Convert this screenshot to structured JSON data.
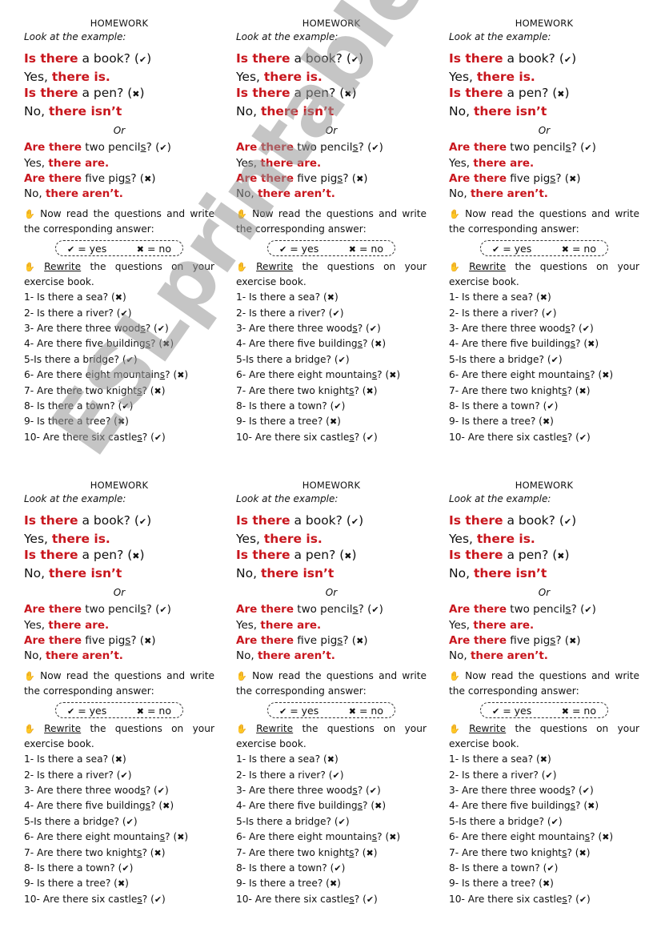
{
  "document": {
    "panel_count": 6,
    "title": "HOMEWORK",
    "look_label": "Look at the example:",
    "examples_singular": [
      {
        "red": "Is there",
        "rest": " a book? ",
        "mark": "✔"
      },
      {
        "prefix": "Yes, ",
        "red": "there is.",
        "rest": ""
      },
      {
        "red": "Is there",
        "rest": " a pen? ",
        "mark": "✖"
      },
      {
        "prefix": "No, ",
        "red": "there isn’t",
        "rest": ""
      }
    ],
    "or_label": "Or",
    "examples_plural": [
      {
        "red": "Are there",
        "rest_a": " two pencil",
        "rest_u": "s",
        "rest_b": "? ",
        "mark": "✔"
      },
      {
        "prefix": "Yes, ",
        "red": "there are.",
        "rest_a": "",
        "rest_u": "",
        "rest_b": ""
      },
      {
        "red": "Are there",
        "rest_a": " five pig",
        "rest_u": "s",
        "rest_b": "? ",
        "mark": "✖"
      },
      {
        "prefix": "No, ",
        "red": "there aren’t.",
        "rest_a": "",
        "rest_u": "",
        "rest_b": ""
      }
    ],
    "instruction_1": "Now read the questions and write the corresponding answer:",
    "legend": {
      "yes_mark": "✔",
      "yes_label": " = yes",
      "no_mark": "✖",
      "no_label": " = no"
    },
    "instruction_2_underlined": "Rewrite",
    "instruction_2_rest": " the questions on your exercise book.",
    "questions": [
      {
        "a": "1- Is there a sea? ",
        "u": "",
        "b": "",
        "mark": "✖"
      },
      {
        "a": "2- Is there a river? ",
        "u": "",
        "b": "",
        "mark": "✔"
      },
      {
        "a": "3- Are there three wood",
        "u": "s",
        "b": "? ",
        "mark": "✔"
      },
      {
        "a": "4- Are there five building",
        "u": "s",
        "b": "? ",
        "mark": "✖"
      },
      {
        "a": "5-Is there a bridge? ",
        "u": "",
        "b": "",
        "mark": "✔"
      },
      {
        "a": "6- Are there eight mountain",
        "u": "s",
        "b": "? ",
        "mark": "✖"
      },
      {
        "a": "7- Are there two knight",
        "u": "s",
        "b": "? ",
        "mark": "✖"
      },
      {
        "a": "8- Is there a town? ",
        "u": "",
        "b": "",
        "mark": "✔"
      },
      {
        "a": "9- Is there a tree? ",
        "u": "",
        "b": "",
        "mark": "✖"
      },
      {
        "a": "10- Are there six castle",
        "u": "s",
        "b": "? ",
        "mark": "✔"
      }
    ],
    "hand_icon": "✋"
  },
  "watermark": "ESLprintables.com",
  "colors": {
    "accent_red": "#c8161d"
  }
}
